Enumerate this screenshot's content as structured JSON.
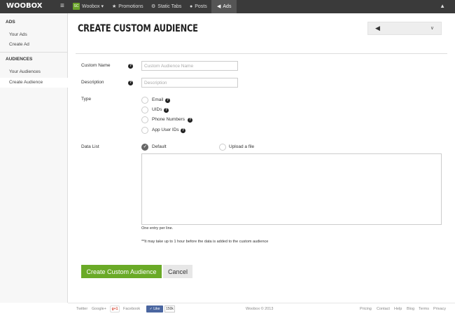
{
  "topbar": {
    "logo": "WOOBOX",
    "hamburger_icon": "hamburger-menu-icon",
    "brand_badge": "SC",
    "brand_label": "Woobox",
    "nav": [
      {
        "label": "Promotions",
        "icon": "star-icon"
      },
      {
        "label": "Static Tabs",
        "icon": "gear-icon"
      },
      {
        "label": "Posts",
        "icon": "comment-icon"
      },
      {
        "label": "Ads",
        "icon": "megaphone-icon"
      }
    ],
    "active_nav": "Ads",
    "user_icon": "user-icon"
  },
  "sidebar": {
    "sections": [
      {
        "heading": "ADS",
        "items": [
          "Your Ads",
          "Create Ad"
        ]
      },
      {
        "heading": "AUDIENCES",
        "items": [
          "Your Audiences",
          "Create Audience"
        ]
      }
    ],
    "active_item": "Create Audience"
  },
  "main": {
    "title": "Create Custom Audience",
    "account_dropdown": {
      "icon": "megaphone-icon",
      "value": "",
      "chevron": "chevron-down-icon"
    },
    "form": {
      "custom_name_label": "Custom Name",
      "custom_name_placeholder": "Custom Audience Name",
      "description_label": "Description",
      "description_placeholder": "Description",
      "type_label": "Type",
      "type_options": [
        "Email",
        "UIDs",
        "Phone Numbers",
        "App User IDs"
      ],
      "data_list_label": "Data List",
      "data_source_options": [
        {
          "label": "Default",
          "checked": true
        },
        {
          "label": "Upload a file",
          "checked": false
        }
      ],
      "textarea_value": "",
      "hint_entry": "One entry per line.",
      "hint_delay": "**It may take up to 1 hour before the data is added to the custom audience"
    },
    "buttons": {
      "submit": "Create Custom Audience",
      "cancel": "Cancel"
    }
  },
  "footer": {
    "left": [
      "Twitter",
      "Google+",
      "Facebook"
    ],
    "gplus": "g+1",
    "fb_like": "Like",
    "fb_count": "150k",
    "copyright": "Woobox © 2013",
    "right": [
      "Pricing",
      "Contact",
      "Help",
      "Blog",
      "Terms",
      "Privacy"
    ]
  },
  "colors": {
    "topbar": "#3a3a3a",
    "accent_green": "#6aaa27",
    "sidebar_bg": "#f7f7f7",
    "facebook_blue": "#4a66a0"
  }
}
